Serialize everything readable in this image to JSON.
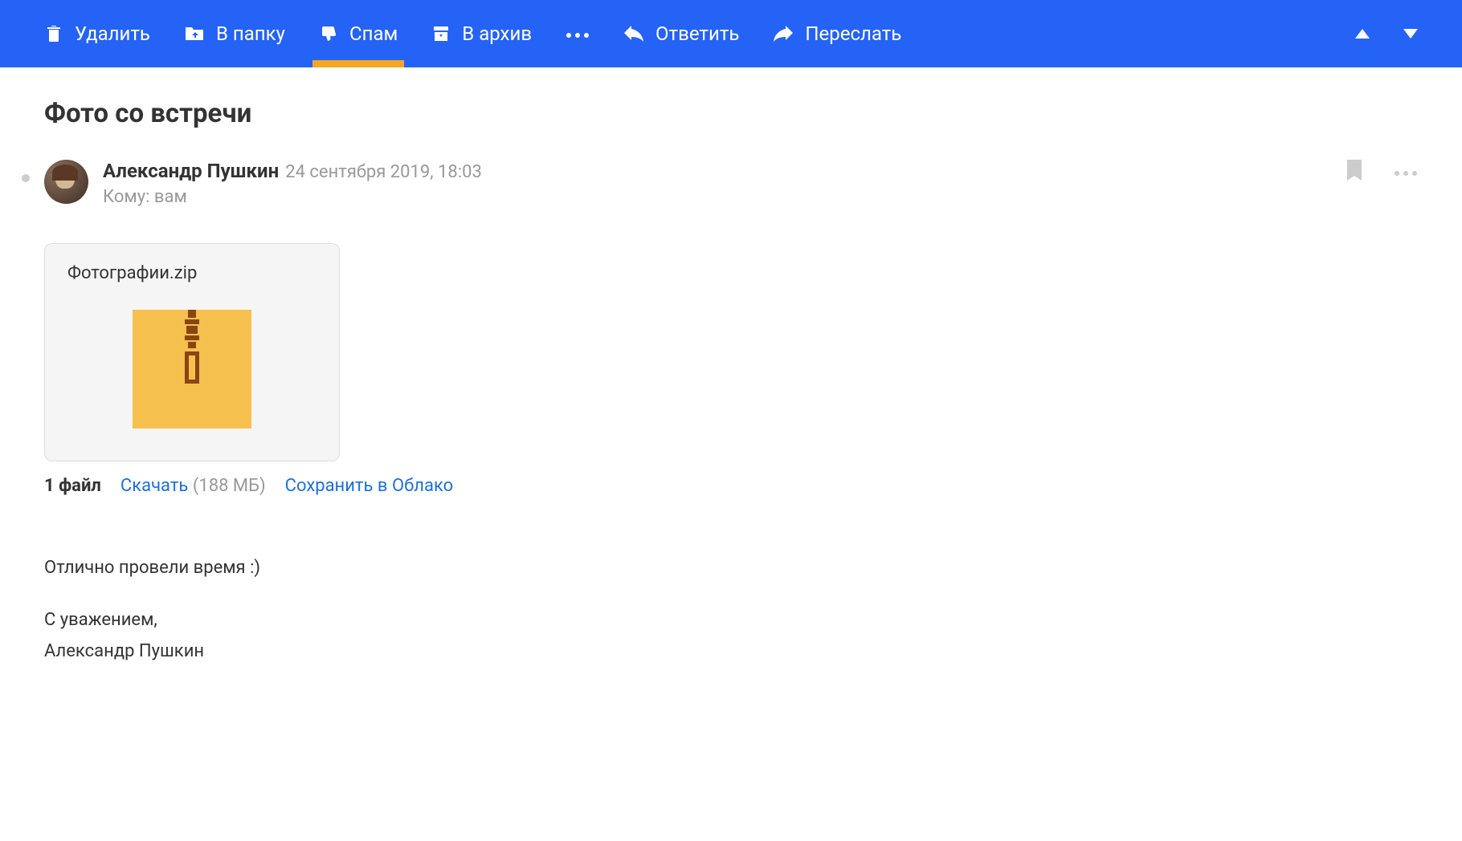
{
  "toolbar": {
    "delete": "Удалить",
    "move": "В папку",
    "spam": "Спам",
    "archive": "В архив",
    "reply": "Ответить",
    "forward": "Переслать"
  },
  "email": {
    "subject": "Фото со встречи",
    "sender_name": "Александр Пушкин",
    "date": "24 сентября 2019, 18:03",
    "recipient_label": "Кому: ",
    "recipient": "вам"
  },
  "attachment": {
    "filename": "Фотографии.zip",
    "file_count": "1 файл",
    "download": "Скачать",
    "size": "(188 МБ)",
    "save_cloud": "Сохранить в Облако"
  },
  "body": {
    "line1": "Отлично провели время :)",
    "line2": "С уважением,",
    "line3": "Александр Пушкин"
  }
}
